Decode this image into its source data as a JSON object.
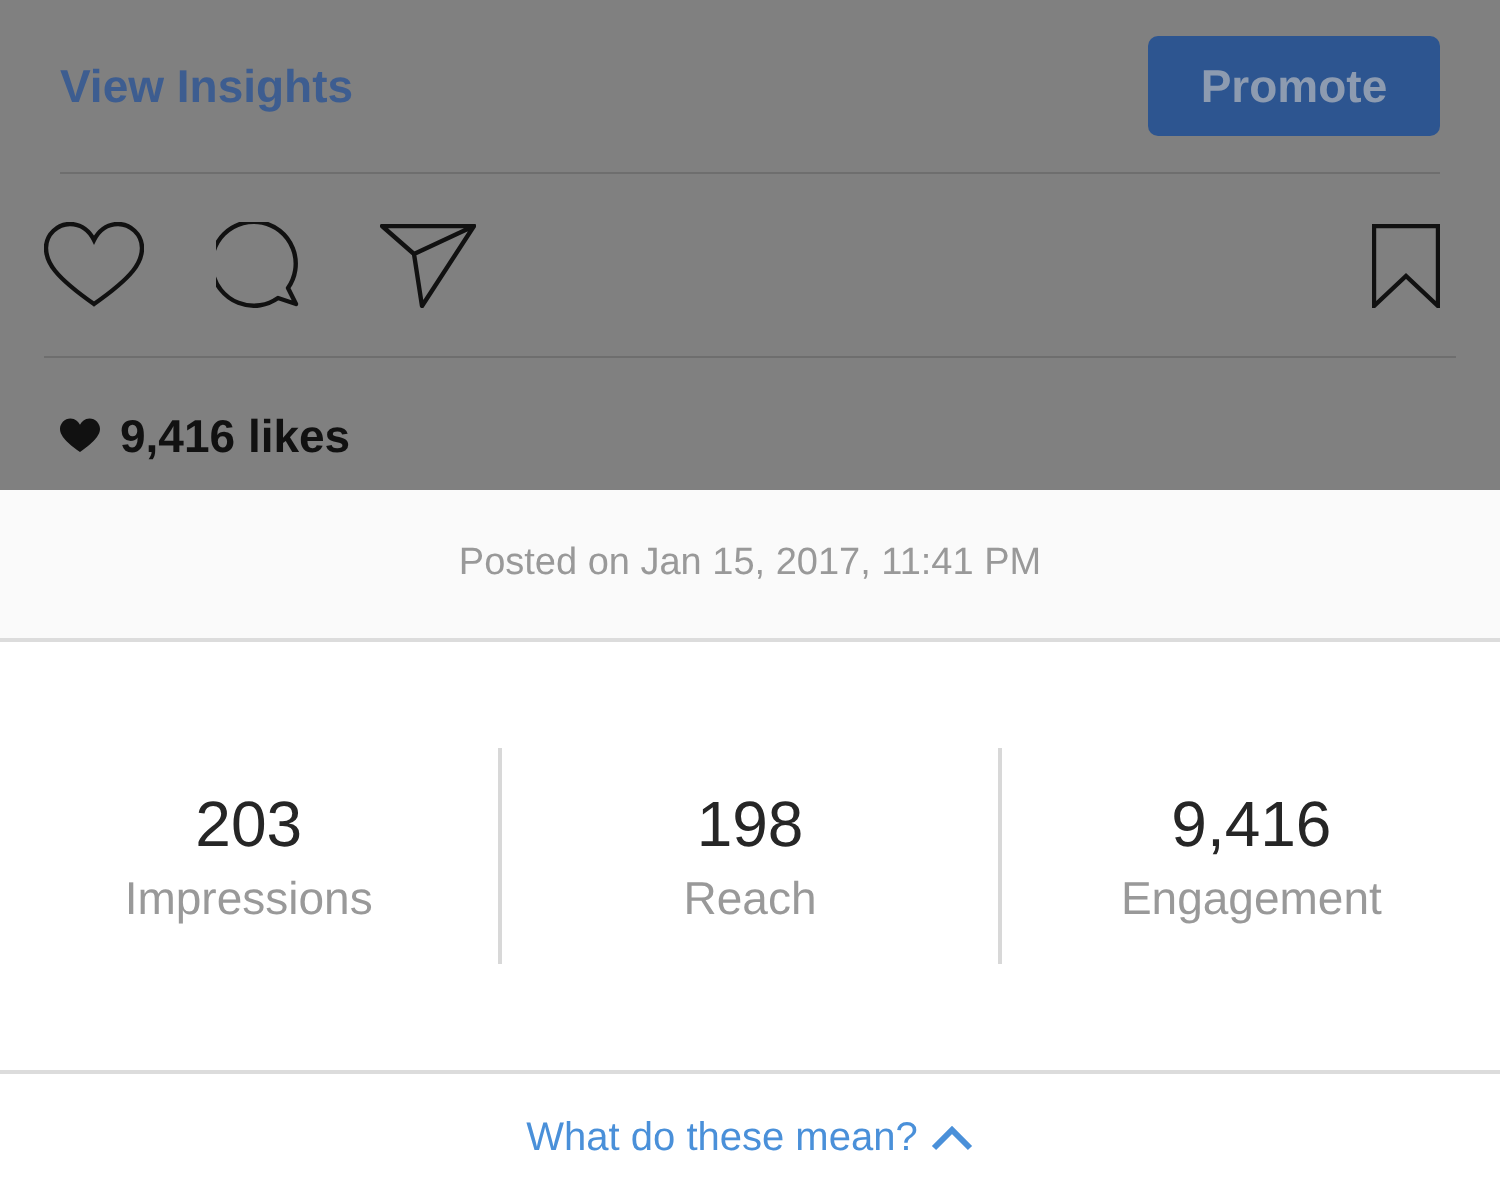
{
  "header": {
    "insights_link": "View Insights",
    "promote_button": "Promote"
  },
  "likes": "9,416 likes",
  "sheet": {
    "posted": "Posted on Jan 15, 2017, 11:41 PM",
    "stats": [
      {
        "value": "203",
        "label": "Impressions"
      },
      {
        "value": "198",
        "label": "Reach"
      },
      {
        "value": "9,416",
        "label": "Engagement"
      }
    ],
    "help_link": "What do these mean?"
  }
}
